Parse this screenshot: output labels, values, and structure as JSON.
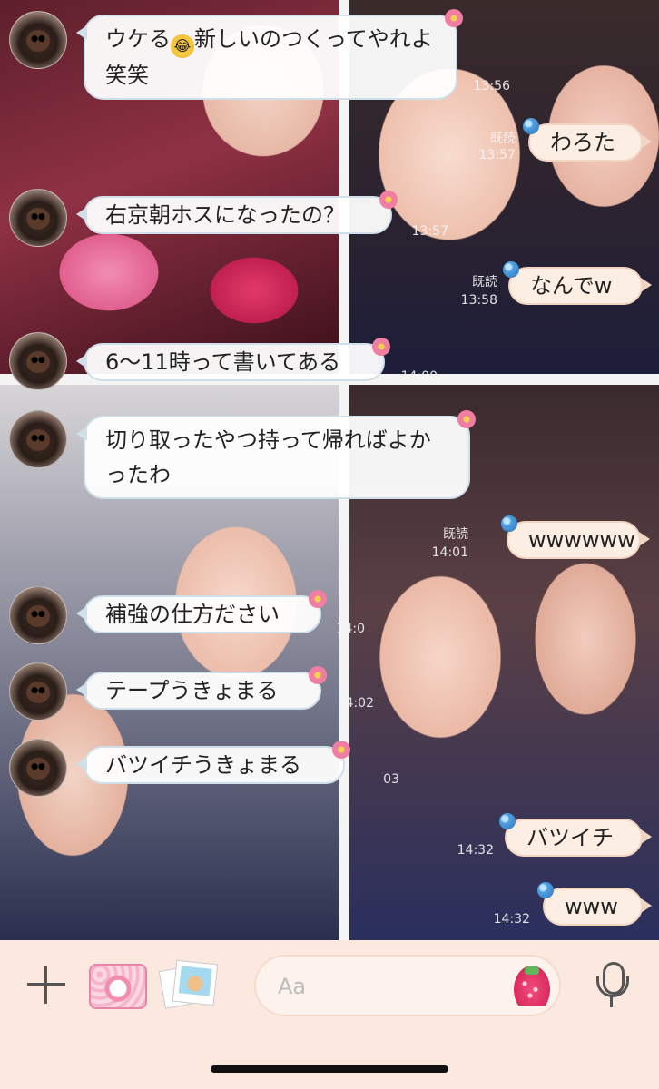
{
  "messages": [
    {
      "dir": "in",
      "text_parts": [
        "ウケる",
        "新しいのつくってやれよ笑笑"
      ],
      "emoji": "rofl-emoji"
    },
    {
      "dir": "out",
      "read": "既読",
      "time": "13:57",
      "text": "わろた"
    },
    {
      "dir": "in",
      "time": "13:57",
      "text": "右京朝ホスになったの？"
    },
    {
      "dir": "out",
      "read": "既読",
      "time": "13:58",
      "text": "なんでw"
    },
    {
      "dir": "in",
      "time": "14:00",
      "text": "6〜11時って書いてある"
    },
    {
      "dir": "in",
      "text": "切り取ったやつ持って帰ればよかったわ"
    },
    {
      "dir": "out",
      "read": "既読",
      "time": "14:01",
      "text": "wwwwww"
    },
    {
      "dir": "in",
      "text": "補強の仕方ださい"
    },
    {
      "dir": "in",
      "text": "テープうきょまる"
    },
    {
      "dir": "in",
      "text": "バツイチうきょまる"
    },
    {
      "dir": "out",
      "time": "14:32",
      "text": "バツイチ"
    },
    {
      "dir": "out",
      "time": "14:32",
      "text": "www"
    }
  ],
  "first_time": "13:56",
  "stray_times": [
    "14:0",
    "14:02",
    "03"
  ],
  "input": {
    "placeholder": "Aa"
  },
  "colors": {
    "bubble_in": "#ffffff",
    "bubble_out": "#fdeee3",
    "input_bar": "#fbe9df"
  },
  "icons": [
    "plus-icon",
    "camera-icon",
    "photos-icon",
    "strawberry-sticker-icon",
    "microphone-icon"
  ]
}
